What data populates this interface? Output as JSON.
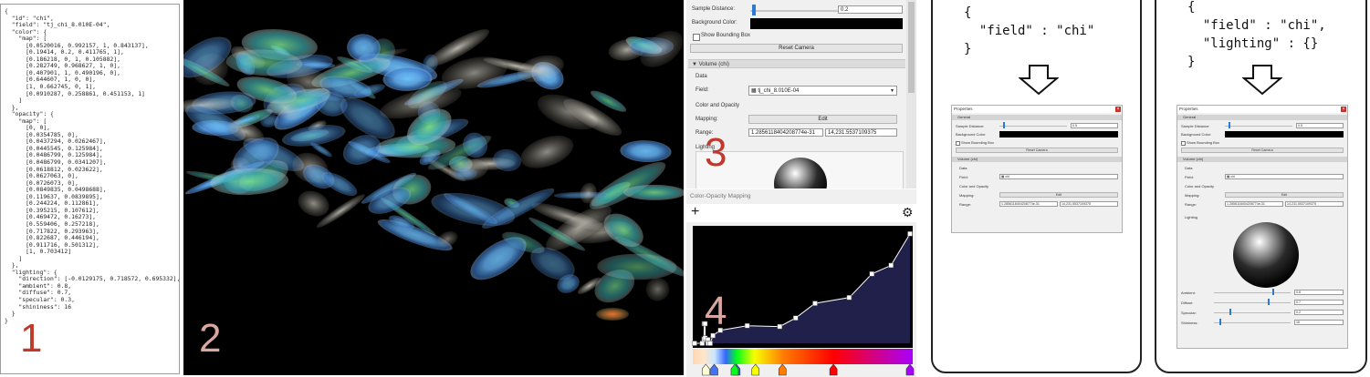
{
  "json_panel": {
    "label": "1",
    "lines": [
      "{",
      "  \"id\": \"chi\",",
      "  \"field\": \"tj_chi_8.010E-04\",",
      "  \"color\": {",
      "    \"map\": [",
      "      [0.0520016, 0.992157, 1, 0.843137],",
      "      [0.19414, 0.2, 0.411765, 1],",
      "      [0.186218, 0, 1, 0.105882],",
      "      [0.282749, 0.968627, 1, 0],",
      "      [0.407901, 1, 0.490196, 0],",
      "      [0.644607, 1, 0, 0],",
      "      [1, 0.662745, 0, 1],",
      "      [0.0910287, 0.258861, 0.451153, 1]",
      "    ]",
      "  },",
      "  \"opacity\": {",
      "    \"map\": [",
      "      [0, 0],",
      "      [0.0354785, 0],",
      "      [0.0437294, 0.0262467],",
      "      [0.0445545, 0.125984],",
      "      [0.0486799, 0.125984],",
      "      [0.0486799, 0.0341207],",
      "      [0.0618812, 0.023622],",
      "      [0.0627063, 0],",
      "      [0.0726073, 0],",
      "      [0.0849835, 0.0498688],",
      "      [0.119637, 0.0839895],",
      "      [0.244224, 0.112861],",
      "      [0.395215, 0.107612],",
      "      [0.469472, 0.16273],",
      "      [0.559406, 0.257218],",
      "      [0.717822, 0.293963],",
      "      [0.822687, 0.446194],",
      "      [0.911716, 0.501312],",
      "      [1, 0.703412]",
      "    ]",
      "  },",
      "  \"lighting\": {",
      "    \"direction\": [-0.0129175, 0.718572, 0.695332],",
      "    \"ambient\": 0.8,",
      "    \"diffuse\": 0.7,",
      "    \"specular\": 0.3,",
      "    \"shininess\": 16",
      "  }",
      "}"
    ]
  },
  "render_panel": {
    "label": "2"
  },
  "properties_panel": {
    "label": "3",
    "sample_distance_label": "Sample Distance:",
    "sample_distance_value": "0.2",
    "background_color_label": "Background Color:",
    "show_bounding_box_label": "Show Bounding Box",
    "reset_camera_label": "Reset Camera",
    "volume_section": "Volume (chi)",
    "data_label": "Data",
    "field_label": "Field:",
    "field_value": "tj_chi_8.010E-04",
    "color_opacity_label": "Color and Opacity",
    "mapping_label": "Mapping:",
    "edit_label": "Edit",
    "range_label": "Range:",
    "range_min": "1.2856118404208774e-31",
    "range_max": "14,231.5537109375",
    "lighting_label": "Lighting"
  },
  "color_opacity_panel": {
    "label": "4",
    "title": "Color-Opacity Mapping",
    "add_icon": "plus",
    "settings_icon": "gear"
  },
  "right_panel_a": {
    "code_lines": [
      "{",
      "  \"field\" : \"chi\"",
      "}"
    ],
    "props": {
      "title": "Properties",
      "general": "General",
      "sample_distance_label": "Sample Distance:",
      "sample_distance_value": "0.5",
      "background_color_label": "Background Color:",
      "show_bounding_box_label": "Show Bounding Box",
      "reset_camera_label": "Reset Camera",
      "volume_section": "Volume (chi)",
      "data_label": "Data",
      "field_label": "Field:",
      "field_value": "chi",
      "color_opacity_label": "Color and Opacity",
      "mapping_label": "Mapping:",
      "edit_label": "Edit",
      "range_label": "Range:",
      "range_min": "1.2856118404208774e-31",
      "range_max": "14,231.5537109375"
    }
  },
  "right_panel_b": {
    "code_lines": [
      "{",
      "  \"field\" : \"chi\",",
      "  \"lighting\" : {}",
      "}"
    ],
    "props": {
      "title": "Properties",
      "general": "General",
      "sample_distance_label": "Sample Distance:",
      "sample_distance_value": "0.5",
      "background_color_label": "Background Color:",
      "show_bounding_box_label": "Show Bounding Box",
      "reset_camera_label": "Reset Camera",
      "volume_section": "Volume (chi)",
      "data_label": "Data",
      "field_label": "Field:",
      "field_value": "chi",
      "color_opacity_label": "Color and Opacity",
      "mapping_label": "Mapping:",
      "edit_label": "Edit",
      "range_label": "Range:",
      "range_min": "1.2856118404208774e-31",
      "range_max": "14,231.5537109375",
      "lighting_label": "Lighting",
      "ambient_label": "Ambient:",
      "ambient_value": "0.8",
      "diffuse_label": "Diffuse:",
      "diffuse_value": "0.7",
      "specular_label": "Specular:",
      "specular_value": "0.2",
      "shininess_label": "Shininess:",
      "shininess_value": "16"
    }
  },
  "colors": {
    "panel_bg": "#f0f0f0",
    "render_bg": "#000000",
    "label_pink": "#d9a7a0",
    "label_red": "#c0392b",
    "close_red": "#c9302c",
    "plot_bg": "#000000",
    "opacity_fill": "#20204a"
  }
}
